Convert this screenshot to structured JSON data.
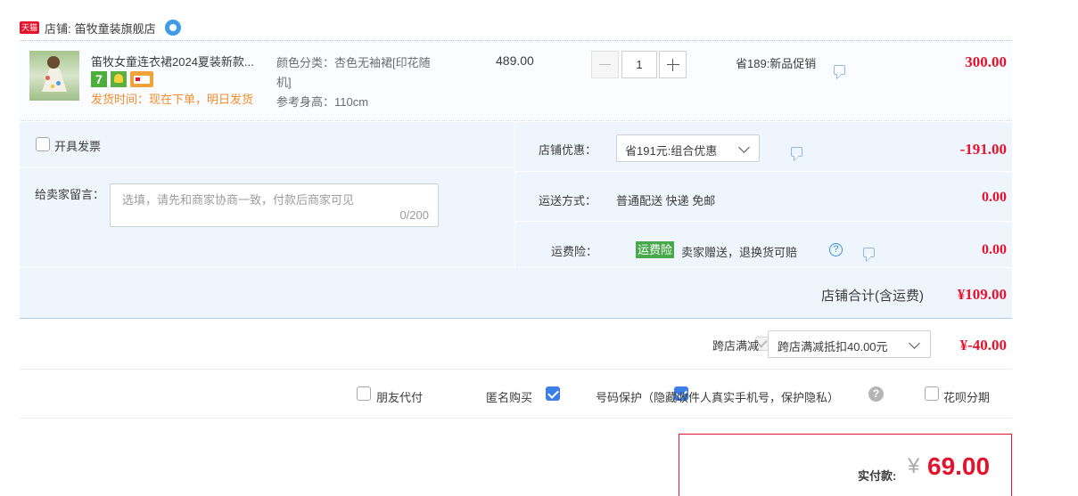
{
  "shop": {
    "badge": "天猫",
    "label": "店铺:",
    "name": "笛牧童装旗舰店"
  },
  "item": {
    "title": "笛牧女童连衣裙2024夏装新款...",
    "badge_seven": "7",
    "ship_time": "发货时间：现在下单，明日发货",
    "spec_color": "颜色分类：杏色无袖裙[印花随",
    "spec_color_2": "机]",
    "spec_size": "参考身高：110cm",
    "unit_price": "489.00",
    "quantity": "1",
    "promo": "省189:新品促销",
    "subtotal": "300.00"
  },
  "invoice_label": "开具发票",
  "message": {
    "label": "给卖家留言：",
    "placeholder": "选填，请先和商家协商一致，付款后商家可见",
    "counter": "0/200"
  },
  "shop_discount": {
    "label": "店铺优惠：",
    "value": "省191元:组合优惠",
    "amount": "-191.00"
  },
  "shipping": {
    "label": "运送方式：",
    "value": "普通配送 快递 免邮",
    "amount": "0.00"
  },
  "insurance": {
    "label": "运费险：",
    "badge": "运费险",
    "text": "卖家赠送，退换货可赔",
    "amount": "0.00"
  },
  "shop_total": {
    "label": "店铺合计(含运费)",
    "amount": "¥109.00"
  },
  "cross_shop": {
    "label": "跨店满减",
    "value": "跨店满减抵扣40.00元",
    "amount": "¥-40.00"
  },
  "options": {
    "friend_pay": "朋友代付",
    "anonymous": "匿名购买",
    "number_protect": "号码保护（隐藏收件人真实手机号，保护隐私）",
    "installment": "花呗分期"
  },
  "payment": {
    "label": "实付款:",
    "currency": "¥",
    "amount": "69.00"
  },
  "colors": {
    "accent_red": "#e4122c",
    "panel_blue": "#eef5fd",
    "border_blue": "#b3cbe6",
    "checkbox_blue": "#3d7ee8",
    "insurance_green": "#47a94a"
  }
}
